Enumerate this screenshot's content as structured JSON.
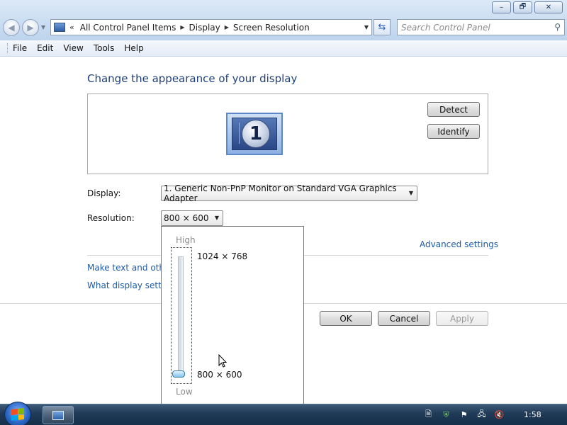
{
  "window": {
    "controls": {
      "minimize": "–",
      "maximize": "🗗",
      "close": "✕"
    }
  },
  "address_bar": {
    "chevron": "«",
    "breadcrumbs": [
      "All Control Panel Items",
      "Display",
      "Screen Resolution"
    ]
  },
  "search": {
    "placeholder": "Search Control Panel"
  },
  "menu": {
    "file": "File",
    "edit": "Edit",
    "view": "View",
    "tools": "Tools",
    "help": "Help"
  },
  "main": {
    "heading": "Change the appearance of your display",
    "monitor_number": "1",
    "detect_label": "Detect",
    "identify_label": "Identify",
    "display_label": "Display:",
    "display_value": "1. Generic Non-PnP Monitor on Standard VGA Graphics Adapter",
    "resolution_label": "Resolution:",
    "resolution_value": "800 × 600",
    "advanced_link": "Advanced settings",
    "link_text_other": "Make text and other",
    "link_display_settings": "What display setting"
  },
  "resolution_popup": {
    "high_label": "High",
    "low_label": "Low",
    "max_option": "1024 × 768",
    "min_option": "800 × 600",
    "selected_fraction": 0
  },
  "buttons": {
    "ok": "OK",
    "cancel": "Cancel",
    "apply": "Apply"
  },
  "taskbar": {
    "clock": "1:58"
  }
}
